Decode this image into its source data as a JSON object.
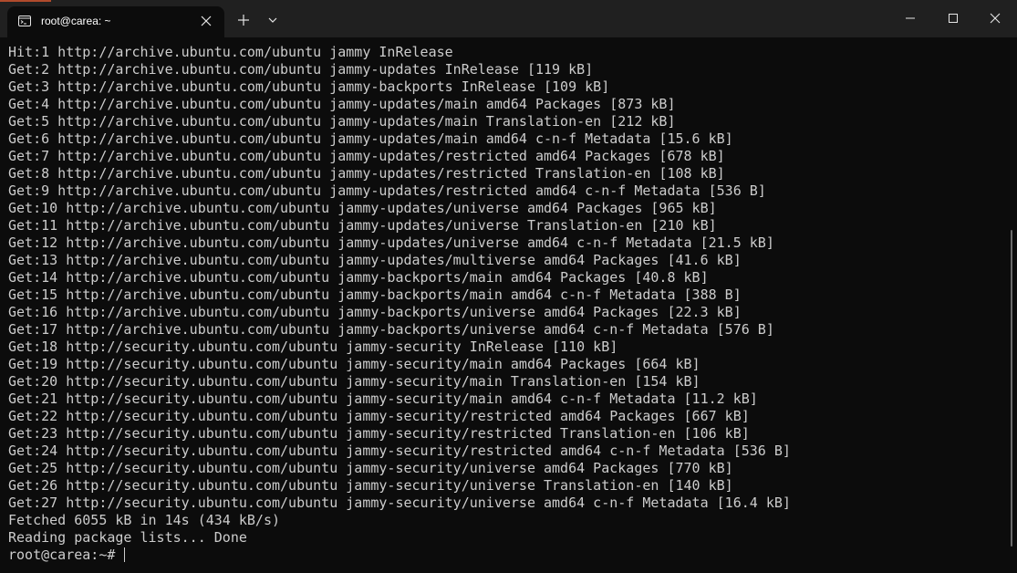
{
  "tab": {
    "title": "root@carea: ~",
    "icon": "terminal-icon"
  },
  "titlebar": {
    "new_tab_icon": "plus-icon",
    "dropdown_icon": "chevron-down-icon",
    "minimize_icon": "minimize-icon",
    "maximize_icon": "maximize-icon",
    "close_icon": "close-icon"
  },
  "colors": {
    "background": "#0c0c0c",
    "titlebar": "#202020",
    "text": "#cccccc"
  },
  "terminal": {
    "lines": [
      "Hit:1 http://archive.ubuntu.com/ubuntu jammy InRelease",
      "Get:2 http://archive.ubuntu.com/ubuntu jammy-updates InRelease [119 kB]",
      "Get:3 http://archive.ubuntu.com/ubuntu jammy-backports InRelease [109 kB]",
      "Get:4 http://archive.ubuntu.com/ubuntu jammy-updates/main amd64 Packages [873 kB]",
      "Get:5 http://archive.ubuntu.com/ubuntu jammy-updates/main Translation-en [212 kB]",
      "Get:6 http://archive.ubuntu.com/ubuntu jammy-updates/main amd64 c-n-f Metadata [15.6 kB]",
      "Get:7 http://archive.ubuntu.com/ubuntu jammy-updates/restricted amd64 Packages [678 kB]",
      "Get:8 http://archive.ubuntu.com/ubuntu jammy-updates/restricted Translation-en [108 kB]",
      "Get:9 http://archive.ubuntu.com/ubuntu jammy-updates/restricted amd64 c-n-f Metadata [536 B]",
      "Get:10 http://archive.ubuntu.com/ubuntu jammy-updates/universe amd64 Packages [965 kB]",
      "Get:11 http://archive.ubuntu.com/ubuntu jammy-updates/universe Translation-en [210 kB]",
      "Get:12 http://archive.ubuntu.com/ubuntu jammy-updates/universe amd64 c-n-f Metadata [21.5 kB]",
      "Get:13 http://archive.ubuntu.com/ubuntu jammy-updates/multiverse amd64 Packages [41.6 kB]",
      "Get:14 http://archive.ubuntu.com/ubuntu jammy-backports/main amd64 Packages [40.8 kB]",
      "Get:15 http://archive.ubuntu.com/ubuntu jammy-backports/main amd64 c-n-f Metadata [388 B]",
      "Get:16 http://archive.ubuntu.com/ubuntu jammy-backports/universe amd64 Packages [22.3 kB]",
      "Get:17 http://archive.ubuntu.com/ubuntu jammy-backports/universe amd64 c-n-f Metadata [576 B]",
      "Get:18 http://security.ubuntu.com/ubuntu jammy-security InRelease [110 kB]",
      "Get:19 http://security.ubuntu.com/ubuntu jammy-security/main amd64 Packages [664 kB]",
      "Get:20 http://security.ubuntu.com/ubuntu jammy-security/main Translation-en [154 kB]",
      "Get:21 http://security.ubuntu.com/ubuntu jammy-security/main amd64 c-n-f Metadata [11.2 kB]",
      "Get:22 http://security.ubuntu.com/ubuntu jammy-security/restricted amd64 Packages [667 kB]",
      "Get:23 http://security.ubuntu.com/ubuntu jammy-security/restricted Translation-en [106 kB]",
      "Get:24 http://security.ubuntu.com/ubuntu jammy-security/restricted amd64 c-n-f Metadata [536 B]",
      "Get:25 http://security.ubuntu.com/ubuntu jammy-security/universe amd64 Packages [770 kB]",
      "Get:26 http://security.ubuntu.com/ubuntu jammy-security/universe Translation-en [140 kB]",
      "Get:27 http://security.ubuntu.com/ubuntu jammy-security/universe amd64 c-n-f Metadata [16.4 kB]",
      "Fetched 6055 kB in 14s (434 kB/s)",
      "Reading package lists... Done"
    ],
    "prompt": "root@carea:~# "
  }
}
